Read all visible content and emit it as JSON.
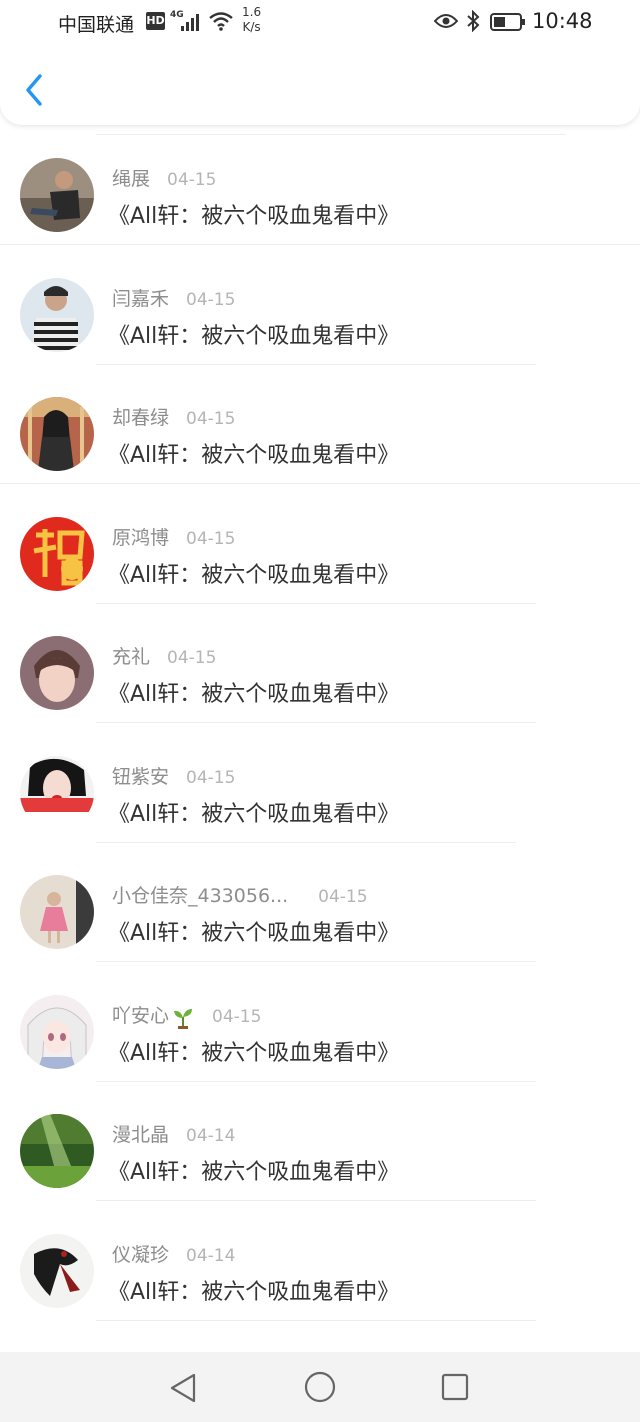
{
  "status_bar": {
    "carrier": "中国联通",
    "hd": "HD",
    "network_type": "4G",
    "speed_value": "1.6",
    "speed_unit": "K/s",
    "time": "10:48"
  },
  "comments": [
    {
      "username": "绳展",
      "date": "04-15",
      "text": "《All轩：被六个吸血鬼看中》",
      "avatar": "avatar-man-sitting"
    },
    {
      "username": "闫嘉禾",
      "date": "04-15",
      "text": "《All轩：被六个吸血鬼看中》",
      "avatar": "avatar-striped-shirt"
    },
    {
      "username": "却春绿",
      "date": "04-15",
      "text": "《All轩：被六个吸血鬼看中》",
      "avatar": "avatar-carousel"
    },
    {
      "username": "原鸿博",
      "date": "04-15",
      "text": "《All轩：被六个吸血鬼看中》",
      "avatar": "avatar-fu-character"
    },
    {
      "username": "充礼",
      "date": "04-15",
      "text": "《All轩：被六个吸血鬼看中》",
      "avatar": "avatar-portrait"
    },
    {
      "username": "钮紫安",
      "date": "04-15",
      "text": "《All轩：被六个吸血鬼看中》",
      "avatar": "avatar-woman-red-lips"
    },
    {
      "username": "小仓佳奈_433056...",
      "date": "04-15",
      "text": "《All轩：被六个吸血鬼看中》",
      "avatar": "avatar-child"
    },
    {
      "username": "吖安心",
      "date": "04-15",
      "text": "《All轩：被六个吸血鬼看中》",
      "avatar": "avatar-anime-girl"
    },
    {
      "username": "漫北晶",
      "date": "04-14",
      "text": "《All轩：被六个吸血鬼看中》",
      "avatar": "avatar-green-landscape"
    },
    {
      "username": "仪凝珍",
      "date": "04-14",
      "text": "《All轩：被六个吸血鬼看中》",
      "avatar": "avatar-ink-figure"
    }
  ],
  "colors": {
    "accent": "#2196f3",
    "username": "#8d8d8d",
    "date": "#b5b5b5",
    "content": "#333333"
  }
}
